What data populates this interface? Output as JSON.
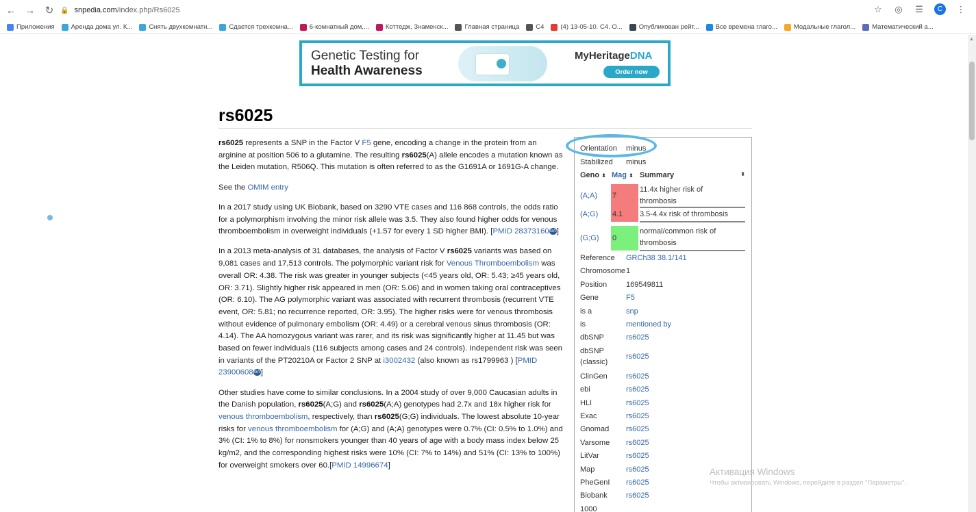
{
  "browser": {
    "url_host": "snpedia.com",
    "url_path": "/index.php/Rs6025",
    "avatar_letter": "C",
    "icons": [
      "back-icon",
      "forward-icon",
      "reload-icon",
      "lock-icon",
      "star-icon",
      "extension-icon",
      "reading-list-icon",
      "profile-avatar",
      "menu-icon"
    ]
  },
  "bookmarks": [
    {
      "label": "Приложения",
      "color": "#4285f4"
    },
    {
      "label": "Аренда дома ул. К...",
      "color": "#3aa7d8"
    },
    {
      "label": "Снять двухкомнатн...",
      "color": "#3aa7d8"
    },
    {
      "label": "Сдается трехкомна...",
      "color": "#3aa7d8"
    },
    {
      "label": "6-комнатный дом,...",
      "color": "#c2185b"
    },
    {
      "label": "Коттедж, Знаменск...",
      "color": "#c2185b"
    },
    {
      "label": "Главная страница",
      "color": "#555555"
    },
    {
      "label": "C4",
      "color": "#555555"
    },
    {
      "label": "(4) 13-05-10. C4. O...",
      "color": "#e53935"
    },
    {
      "label": "Опубликован рейт...",
      "color": "#37474f"
    },
    {
      "label": "Все времена глаго...",
      "color": "#1e88e5"
    },
    {
      "label": "Модальные глагол...",
      "color": "#f9a825"
    },
    {
      "label": "Математический а...",
      "color": "#5c6bc0"
    }
  ],
  "ad": {
    "line1": "Genetic Testing for",
    "line2": "Health Awareness",
    "brand": "MyHeritage",
    "brand_suffix": "DNA",
    "cta": "Order now"
  },
  "article": {
    "title": "rs6025",
    "p1": {
      "b1": "rs6025",
      "t1": " represents a SNP in the Factor V ",
      "link1": "F5",
      "t2": " gene, encoding a change in the protein from an arginine at position 506 to a glutamine. The resulting ",
      "b2": "rs6025",
      "t3": "(A) allele encodes a mutation known as the Leiden mutation, R506Q. This mutation is often referred to as the G1691A or 1691G-A change."
    },
    "p2": {
      "t1": "See the ",
      "link1": "OMIM entry"
    },
    "p3": {
      "t1": "In a 2017 study using UK Biobank, based on 3290 VTE cases and 116 868 controls, the odds ratio for a polymorphism involving the minor risk allele was 3.5. They also found higher odds for venous thromboembolism in overweight individuals (+1.57 for every 1 SD higher BMI). [",
      "link1": "PMID 28373160",
      "t2": "]"
    },
    "p4": {
      "t1": "In a 2013 meta-analysis of 31 databases, the analysis of Factor V ",
      "b1": "rs6025",
      "t2": " variants was based on 9,081 cases and 17,513 controls. The polymorphic variant risk for ",
      "link1": "Venous Thromboembolism",
      "t3": " was overall OR: 4.38. The risk was greater in younger subjects (<45 years old, OR: 5.43; ≥45 years old, OR: 3.71). Slightly higher risk appeared in men (OR: 5.06) and in women taking oral contraceptives (OR: 6.10). The AG polymorphic variant was associated with recurrent thrombosis (recurrent VTE event, OR: 5.81; no recurrence reported, OR: 3.95). The higher risks were for venous thrombosis without evidence of pulmonary embolism (OR: 4.49) or a cerebral venous sinus thrombosis (OR: 4.14). The AA homozygous variant was rarer, and its risk was significantly higher at 11.45 but was based on fewer individuals (116 subjects among cases and 24 controls). Independent risk was seen in variants of the PT20210A or Factor 2 SNP at ",
      "link2": "i3002432",
      "t4": " (also known as rs1799963 ) [",
      "link3": "PMID 23900608",
      "t5": "]"
    },
    "p5": {
      "t1": "Other studies have come to similar conclusions. In a 2004 study of over 9,000 Caucasian adults in the Danish population, ",
      "b1": "rs6025",
      "t2": "(A;G) and ",
      "b2": "rs6025",
      "t3": "(A;A) genotypes had 2.7x and 18x higher risk for ",
      "link1": "venous thromboembolism",
      "t4": ", respectively, than ",
      "b3": "rs6025",
      "t5": "(G;G) individuals. The lowest absolute 10-year risks for ",
      "link2": "venous thromboembolism",
      "t6": " for (A;G) and (A;A) genotypes were 0.7% (CI: 0.5% to 1.0%) and 3% (CI: 1% to 8%) for nonsmokers younger than 40 years of age with a body mass index below 25 kg/m2, and the corresponding highest risks were 10% (CI: 7% to 14%) and 51% (CI: 13% to 100%) for overweight smokers over 60.[",
      "link3": "PMID 14996674",
      "t7": "]"
    },
    "badge": "GA"
  },
  "infobox": {
    "orientation": {
      "label": "Orientation",
      "value": "minus"
    },
    "stabilized": {
      "label": "Stabilized",
      "value": "minus"
    },
    "headers": {
      "geno": "Geno",
      "mag": "Mag",
      "summary": "Summary"
    },
    "genotypes": [
      {
        "geno": "(A;A)",
        "mag": "7",
        "summary_l1": "11.4x higher risk of",
        "summary_l2": "thrombosis",
        "color": "#f47c7c"
      },
      {
        "geno": "(A;G)",
        "mag": "4.1",
        "summary_l1": "3.5-4.4x risk of thrombosis",
        "summary_l2": "",
        "color": "#f47c7c"
      },
      {
        "geno": "(G;G)",
        "mag": "0",
        "summary_l1": "normal/common risk of",
        "summary_l2": "thrombosis",
        "color": "#7cf07c"
      }
    ],
    "rows": [
      {
        "key": "Reference",
        "value": "GRCh38 38.1/141",
        "link": true
      },
      {
        "key": "Chromosome",
        "value": "1",
        "link": false
      },
      {
        "key": "Position",
        "value": "169549811",
        "link": false
      },
      {
        "key": "Gene",
        "value": "F5",
        "link": true
      },
      {
        "key": "is a",
        "value": "snp",
        "link": true
      },
      {
        "key": "is",
        "value": "mentioned by",
        "link": true
      },
      {
        "key": "dbSNP",
        "value": "rs6025",
        "link": true
      },
      {
        "key": "dbSNP (classic)",
        "value": "rs6025",
        "link": true
      },
      {
        "key": "ClinGen",
        "value": "rs6025",
        "link": true
      },
      {
        "key": "ebi",
        "value": "rs6025",
        "link": true
      },
      {
        "key": "HLI",
        "value": "rs6025",
        "link": true
      },
      {
        "key": "Exac",
        "value": "rs6025",
        "link": true
      },
      {
        "key": "Gnomad",
        "value": "rs6025",
        "link": true
      },
      {
        "key": "Varsome",
        "value": "rs6025",
        "link": true
      },
      {
        "key": "LitVar",
        "value": "rs6025",
        "link": true
      },
      {
        "key": "Map",
        "value": "rs6025",
        "link": true
      },
      {
        "key": "PheGenI",
        "value": "rs6025",
        "link": true
      },
      {
        "key": "Biobank",
        "value": "rs6025",
        "link": true
      },
      {
        "key": "1000",
        "value": "",
        "link": false
      }
    ]
  },
  "windows_activation": {
    "title": "Активация Windows",
    "subtitle": "Чтобы активировать Windows, перейдите в раздел \"Параметры\"."
  }
}
